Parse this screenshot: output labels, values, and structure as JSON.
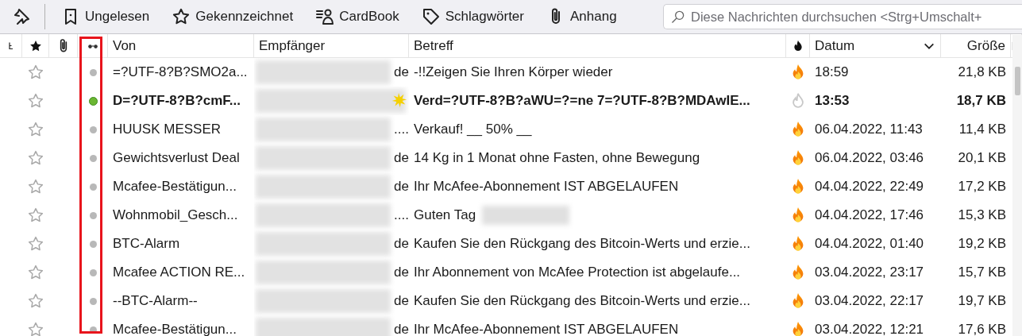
{
  "toolbar": {
    "buttons": [
      {
        "kind": "bookmark",
        "label": "Ungelesen"
      },
      {
        "kind": "star",
        "label": "Gekennzeichnet"
      },
      {
        "kind": "contact",
        "label": "CardBook"
      },
      {
        "kind": "tag",
        "label": "Schlagwörter"
      },
      {
        "kind": "clip",
        "label": "Anhang"
      }
    ],
    "search": {
      "placeholder": "Diese Nachrichten durchsuchen <Strg+Umschalt+"
    }
  },
  "table": {
    "columns": [
      {
        "kind": "thread"
      },
      {
        "kind": "star"
      },
      {
        "kind": "attachment"
      },
      {
        "kind": "read"
      },
      {
        "kind": "text",
        "label": "Von"
      },
      {
        "kind": "text",
        "label": "Empfänger"
      },
      {
        "kind": "text",
        "label": "Betreff"
      },
      {
        "kind": "junk"
      },
      {
        "kind": "sorted",
        "label": "Datum"
      },
      {
        "kind": "text",
        "label": "Größe"
      },
      {
        "kind": "picker"
      }
    ],
    "rows": [
      {
        "starred": false,
        "unread": false,
        "new": false,
        "junk": true,
        "from": "=?UTF-8?B?SMO2a...",
        "recipient": "de",
        "subject": "-!!Zeigen Sie Ihren Körper wieder",
        "subject_redacted": false,
        "date": "18:59",
        "size": "21,8 KB"
      },
      {
        "starred": false,
        "unread": true,
        "new": true,
        "junk": false,
        "from": "D=?UTF-8?B?cmF...",
        "subject": "Verd=?UTF-8?B?aWU=?=ne 7=?UTF-8?B?MDAwIE...",
        "subject_redacted": false,
        "date": "13:53",
        "size": "18,7 KB"
      },
      {
        "starred": false,
        "unread": false,
        "new": false,
        "junk": true,
        "from": "HUUSK MESSER",
        "recipient": "....",
        "subject": "Verkauf! __ 50% __",
        "subject_redacted": false,
        "date": "06.04.2022, 11:43",
        "size": "11,4 KB"
      },
      {
        "starred": false,
        "unread": false,
        "new": false,
        "junk": true,
        "from": "Gewichtsverlust Deal",
        "recipient": "de",
        "subject": "14 Kg in 1 Monat ohne Fasten, ohne Bewegung",
        "subject_redacted": false,
        "date": "06.04.2022, 03:46",
        "size": "20,1 KB"
      },
      {
        "starred": false,
        "unread": false,
        "new": false,
        "junk": true,
        "from": "Mcafee-Bestätigun...",
        "recipient": "de",
        "subject": "Ihr McAfee-Abonnement IST ABGELAUFEN",
        "subject_redacted": false,
        "date": "04.04.2022, 22:49",
        "size": "17,2 KB"
      },
      {
        "starred": false,
        "unread": false,
        "new": false,
        "junk": true,
        "from": "Wohnmobil_Gesch...",
        "recipient": "....",
        "subject": "Guten Tag",
        "subject_redacted": true,
        "date": "04.04.2022, 17:46",
        "size": "15,3 KB"
      },
      {
        "starred": false,
        "unread": false,
        "new": false,
        "junk": true,
        "from": "BTC-Alarm",
        "recipient": "de",
        "subject": "Kaufen Sie den Rückgang des Bitcoin-Werts und erzie...",
        "subject_redacted": false,
        "date": "04.04.2022, 01:40",
        "size": "19,2 KB"
      },
      {
        "starred": false,
        "unread": false,
        "new": false,
        "junk": true,
        "from": "Mcafee ACTION RE...",
        "recipient": "de",
        "subject": "Ihr Abonnement von McAfee Protection ist abgelaufe...",
        "subject_redacted": false,
        "date": "03.04.2022, 23:17",
        "size": "15,7 KB"
      },
      {
        "starred": false,
        "unread": false,
        "new": false,
        "junk": true,
        "from": "--BTC-Alarm--",
        "recipient": "de",
        "subject": "Kaufen Sie den Rückgang des Bitcoin-Werts und erzie...",
        "subject_redacted": false,
        "date": "03.04.2022, 22:17",
        "size": "19,7 KB"
      },
      {
        "starred": false,
        "unread": false,
        "new": false,
        "junk": true,
        "from": "Mcafee-Bestätigun...",
        "recipient": "de",
        "subject": "Ihr McAfee-Abonnement IST ABGELAUFEN",
        "subject_redacted": false,
        "date": "03.04.2022, 12:21",
        "size": "17,6 KB"
      }
    ]
  }
}
